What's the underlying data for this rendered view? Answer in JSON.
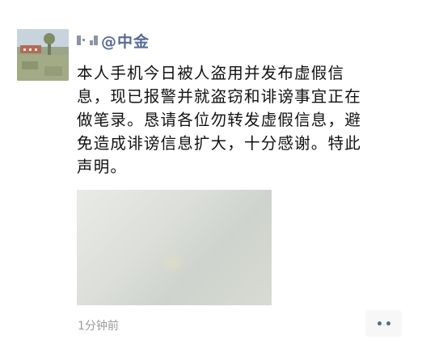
{
  "post": {
    "author": "@中金",
    "text": "本人手机今日被人盗用并发布虚假信息，现已报警并就盗窃和诽谤事宜正在做笔录。恳请各位勿转发虚假信息，避免造成诽谤信息扩大，十分感谢。特此声明。",
    "timestamp": "1分钟前"
  },
  "icons": {
    "avatar": "avatar-photo",
    "more": "more-options-icon"
  },
  "colors": {
    "author_name": "#576b95",
    "text": "#111111",
    "timestamp": "#9a9a9a",
    "more_button_bg": "#f7f7f7"
  }
}
